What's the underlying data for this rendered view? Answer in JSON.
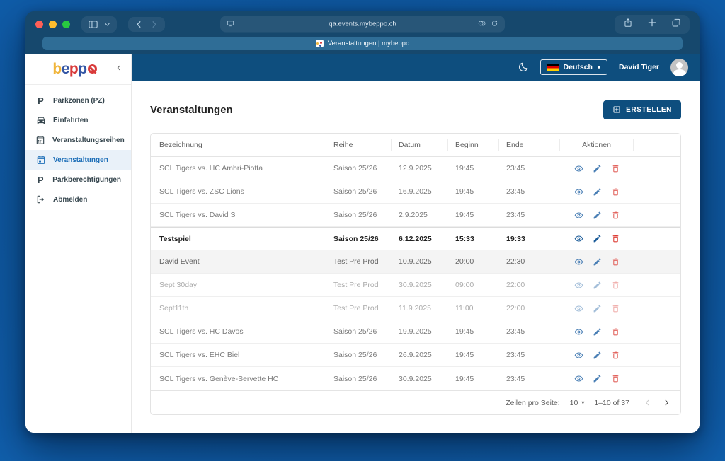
{
  "browser": {
    "url": "qa.events.mybeppo.ch",
    "tab_title": "Veranstaltungen | mybeppo"
  },
  "sidebar": {
    "logo_letters": [
      {
        "ch": "b",
        "color": "#f0b53b"
      },
      {
        "ch": "e",
        "color": "#3356a5"
      },
      {
        "ch": "p",
        "color": "#d93a3a"
      },
      {
        "ch": "p",
        "color": "#3356a5"
      }
    ],
    "items": [
      {
        "id": "parkzonen",
        "label": "Parkzonen (PZ)",
        "icon": "parking-icon",
        "active": false
      },
      {
        "id": "einfahrten",
        "label": "Einfahrten",
        "icon": "car-icon",
        "active": false
      },
      {
        "id": "veranstaltungsreihen",
        "label": "Veranstaltungsreihen",
        "icon": "calendar-month-icon",
        "active": false
      },
      {
        "id": "veranstaltungen",
        "label": "Veranstaltungen",
        "icon": "calendar-event-icon",
        "active": true
      },
      {
        "id": "parkberechtigungen",
        "label": "Parkberechtigungen",
        "icon": "parking-icon",
        "active": false
      },
      {
        "id": "abmelden",
        "label": "Abmelden",
        "icon": "logout-icon",
        "active": false
      }
    ]
  },
  "header": {
    "language": "Deutsch",
    "user_name": "David Tiger"
  },
  "main": {
    "title": "Veranstaltungen",
    "create_button": "ERSTELLEN"
  },
  "table": {
    "columns": [
      "Bezeichnung",
      "Reihe",
      "Datum",
      "Beginn",
      "Ende",
      "Aktionen"
    ],
    "rows": [
      {
        "bezeichnung": "SCL Tigers vs. HC Ambri-Piotta",
        "reihe": "Saison 25/26",
        "datum": "12.9.2025",
        "beginn": "19:45",
        "ende": "23:45",
        "variant": "normal",
        "highlighted": false
      },
      {
        "bezeichnung": "SCL Tigers vs. ZSC Lions",
        "reihe": "Saison 25/26",
        "datum": "16.9.2025",
        "beginn": "19:45",
        "ende": "23:45",
        "variant": "normal",
        "highlighted": false
      },
      {
        "bezeichnung": "SCL Tigers vs. David S",
        "reihe": "Saison 25/26",
        "datum": "2.9.2025",
        "beginn": "19:45",
        "ende": "23:45",
        "variant": "normal",
        "highlighted": false
      },
      {
        "bezeichnung": "Testspiel",
        "reihe": "Saison 25/26",
        "datum": "6.12.2025",
        "beginn": "15:33",
        "ende": "19:33",
        "variant": "bold",
        "highlighted": false
      },
      {
        "bezeichnung": "David Event",
        "reihe": "Test Pre Prod",
        "datum": "10.9.2025",
        "beginn": "20:00",
        "ende": "22:30",
        "variant": "normal",
        "highlighted": true
      },
      {
        "bezeichnung": "Sept 30day",
        "reihe": "Test Pre Prod",
        "datum": "30.9.2025",
        "beginn": "09:00",
        "ende": "22:00",
        "variant": "faded",
        "highlighted": false
      },
      {
        "bezeichnung": "Sept11th",
        "reihe": "Test Pre Prod",
        "datum": "11.9.2025",
        "beginn": "11:00",
        "ende": "22:00",
        "variant": "faded",
        "highlighted": false
      },
      {
        "bezeichnung": "SCL Tigers vs. HC Davos",
        "reihe": "Saison 25/26",
        "datum": "19.9.2025",
        "beginn": "19:45",
        "ende": "23:45",
        "variant": "normal",
        "highlighted": false
      },
      {
        "bezeichnung": "SCL Tigers vs. EHC Biel",
        "reihe": "Saison 25/26",
        "datum": "26.9.2025",
        "beginn": "19:45",
        "ende": "23:45",
        "variant": "normal",
        "highlighted": false
      },
      {
        "bezeichnung": "SCL Tigers vs. Genève-Servette HC",
        "reihe": "Saison 25/26",
        "datum": "30.9.2025",
        "beginn": "19:45",
        "ende": "23:45",
        "variant": "normal",
        "highlighted": false
      }
    ],
    "pagination": {
      "rows_per_page_label": "Zeilen pro Seite:",
      "rows_per_page": "10",
      "range": "1–10 of 37"
    }
  },
  "colors": {
    "brand_blue": "#0e4e7e",
    "active_item_blue": "#1e6fb8",
    "logo_yellow": "#f0b53b",
    "logo_blue": "#3356a5",
    "logo_red": "#d93a3a",
    "action_blue": "#4a7fb5",
    "action_red": "#e2635d",
    "desktop_blue": "#1a74c4"
  }
}
